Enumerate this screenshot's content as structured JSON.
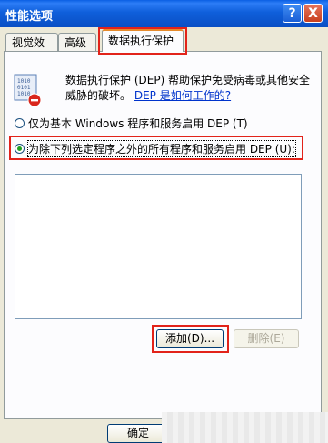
{
  "window": {
    "title": "性能选项"
  },
  "titlebar": {
    "help_glyph": "?",
    "close_glyph": "X"
  },
  "tabs": [
    {
      "label": "视觉效果"
    },
    {
      "label": "高级"
    },
    {
      "label": "数据执行保护",
      "active": true
    }
  ],
  "dep": {
    "description": "数据执行保护 (DEP) 帮助保护免受病毒或其他安全威胁的破坏。",
    "link": "DEP 是如何工作的?",
    "option_essential": "仅为基本 Windows 程序和服务启用 DEP (T)",
    "option_all_except": "为除下列选定程序之外的所有程序和服务启用 DEP (U):",
    "selected_option": "all_except"
  },
  "buttons": {
    "add": "添加(D)...",
    "remove": "删除(E)",
    "ok": "确定"
  },
  "colors": {
    "highlight": "#e2231a",
    "titlebar": "#0a5fe3"
  }
}
